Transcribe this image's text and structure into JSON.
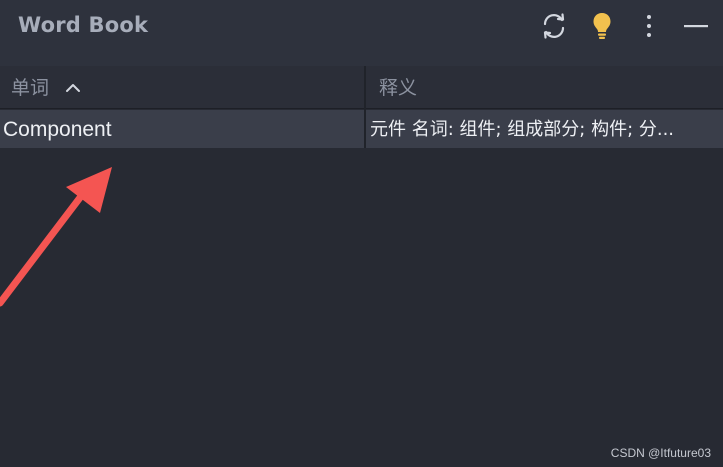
{
  "window": {
    "title": "Word Book",
    "icons": [
      "refresh-icon",
      "lightbulb-icon",
      "more-vert-icon",
      "minimize-icon"
    ],
    "lightbulb_color": "#f2c14e"
  },
  "table": {
    "columns": [
      {
        "label": "单词",
        "sort": "ascending",
        "sort_icon": "chevron-up-icon"
      },
      {
        "label": "释义"
      }
    ],
    "rows": [
      {
        "word": "Component",
        "definition": "元件  名词: 组件; 组成部分; 构件; 分..."
      }
    ]
  },
  "annotation": {
    "arrow_color": "#f45552"
  },
  "watermark": "CSDN @Itfuture03"
}
